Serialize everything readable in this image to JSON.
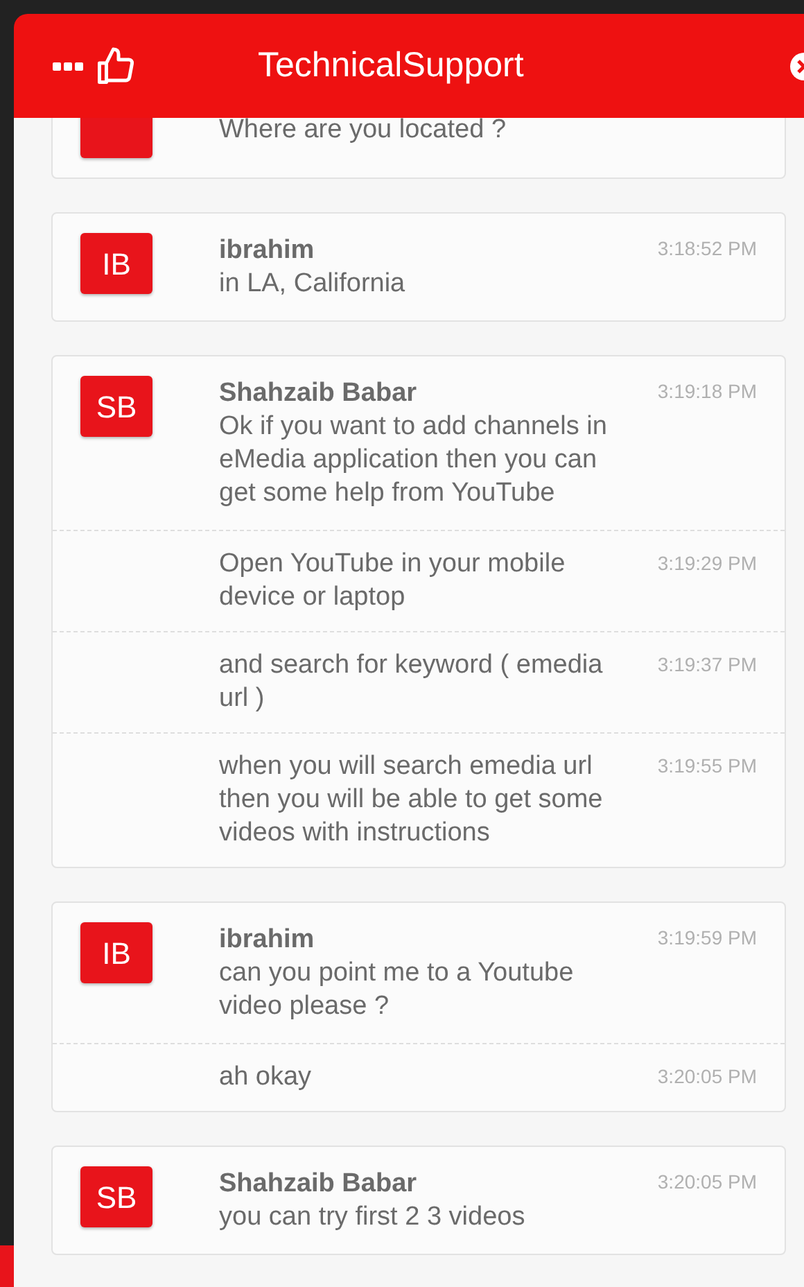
{
  "header": {
    "title": "TechnicalSupport"
  },
  "conversation": [
    {
      "partial": true,
      "entries": [
        {
          "text": "Where are you located ?"
        }
      ]
    },
    {
      "partial": false,
      "avatar": "IB",
      "name": "ibrahim",
      "entries": [
        {
          "text": "in LA, California",
          "time": "3:18:52 PM"
        }
      ]
    },
    {
      "partial": false,
      "avatar": "SB",
      "name": "Shahzaib Babar",
      "entries": [
        {
          "text": "Ok if you want to add channels in eMedia application then you can get some help from YouTube",
          "time": "3:19:18 PM"
        },
        {
          "text": "Open YouTube in your mobile device or laptop",
          "time": "3:19:29 PM"
        },
        {
          "text": "and search for keyword ( emedia url )",
          "time": "3:19:37 PM"
        },
        {
          "text": "when you will search emedia url then you will be able to get some videos with instructions",
          "time": "3:19:55 PM"
        }
      ]
    },
    {
      "partial": false,
      "avatar": "IB",
      "name": "ibrahim",
      "entries": [
        {
          "text": "can you point me to a Youtube video please ?",
          "time": "3:19:59 PM"
        },
        {
          "text": "ah okay",
          "time": "3:20:05 PM"
        }
      ]
    },
    {
      "partial": false,
      "avatar": "SB",
      "name": "Shahzaib Babar",
      "entries": [
        {
          "text": "you can try first 2 3 videos",
          "time": "3:20:05 PM"
        }
      ]
    }
  ]
}
